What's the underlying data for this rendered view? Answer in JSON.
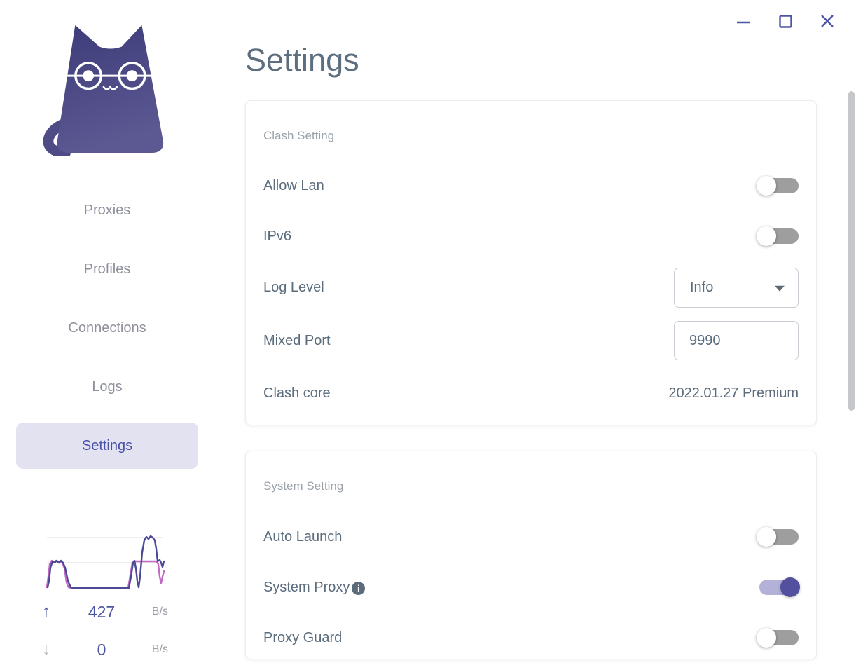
{
  "window": {
    "controls": [
      {
        "name": "minimize"
      },
      {
        "name": "maximize"
      },
      {
        "name": "close"
      }
    ]
  },
  "sidebar": {
    "logo": "clash-cat",
    "items": [
      {
        "label": "Proxies",
        "active": false
      },
      {
        "label": "Profiles",
        "active": false
      },
      {
        "label": "Connections",
        "active": false
      },
      {
        "label": "Logs",
        "active": false
      },
      {
        "label": "Settings",
        "active": true
      }
    ],
    "traffic": {
      "upload_value": "427",
      "upload_unit": "B/s",
      "download_value": "0",
      "download_unit": "B/s"
    }
  },
  "main": {
    "title": "Settings"
  },
  "cards": [
    {
      "title": "Clash Setting",
      "rows": [
        {
          "label": "Allow Lan",
          "type": "toggle",
          "state": "off"
        },
        {
          "label": "IPv6",
          "type": "toggle",
          "state": "off"
        },
        {
          "label": "Log Level",
          "type": "select",
          "value": "Info"
        },
        {
          "label": "Mixed Port",
          "type": "input",
          "value": "9990"
        },
        {
          "label": "Clash core",
          "type": "text",
          "value": "2022.01.27 Premium"
        }
      ]
    },
    {
      "title": "System Setting",
      "rows": [
        {
          "label": "Auto Launch",
          "type": "toggle",
          "state": "off"
        },
        {
          "label": "System Proxy",
          "type": "toggle",
          "state": "on",
          "info_icon": true
        },
        {
          "label": "Proxy Guard",
          "type": "toggle",
          "state": "off"
        }
      ]
    }
  ],
  "colors": {
    "accent_indigo": "#4d54a6",
    "active_nav_bg": "#e3e2f1",
    "active_nav_text": "#4952a8",
    "label_slate": "#5b6c7d",
    "section_label_gray": "#9aa1a9",
    "toggle_off_track": "#9e9e9e",
    "toggle_on_track": "#b4b1d8",
    "toggle_on_knob": "#53509f",
    "chart_upload_line": "#4c4a95",
    "chart_download_line": "#c36ac6",
    "cat_gradient_top": "#3e3c79",
    "cat_gradient_bottom": "#5b5892"
  }
}
